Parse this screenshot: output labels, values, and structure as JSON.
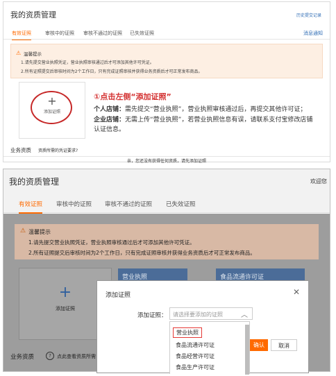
{
  "panel1": {
    "title": "我的资质管理",
    "history_link": "历史提交记录",
    "tabs": [
      "有效证照",
      "审核中的证照",
      "审核不通过的证照",
      "已失效证照"
    ],
    "message_link": "消息通知",
    "tip": {
      "heading": "温馨提示",
      "line1": "1.请先提交营业执照凭证，营业执照审核通过后才可添加其他许可凭证。",
      "line2": "2.所有证照提交后审核时间为2个工作日，只有完成证照审核并获得业务资质后才可正常发布商品。"
    },
    "add_label": "添加证照",
    "step_title": "①点击左侧“添加证照”",
    "personal_label": "个人店铺：",
    "personal_text": "需先提交“营业执照”，营业执照审核通过后，再提交其他许可证；",
    "enterprise_label": "企业店铺：",
    "enterprise_text": "无需上传“营业执照”，若营业执照信息有误，请联系支付宝修改店铺认证信息。",
    "business_label": "业务资质",
    "business_hint": "资质所需的凭证要求?",
    "footer": "亲，您还没有获得任何资质，请先添加证照"
  },
  "panel2": {
    "title": "我的资质管理",
    "welcome": "欢迎您",
    "tabs": [
      "有效证照",
      "审核中的证照",
      "审核不通过的证照",
      "已失效证照"
    ],
    "tip": {
      "heading": "温馨提示",
      "line1": "1.请先提交营业执照凭证，营业执照审核通过后才可添加其他许可凭证。",
      "line2": "2.所有证照提交后审核时间为2个工作日，只有完成证照审核并获得业务资质后才可正常发布商品。"
    },
    "add_label": "添加证照",
    "card1": "营业执照",
    "card2": "食品流通许可证",
    "business_label": "业务资质",
    "business_hint": "点此查看资质所需",
    "dialog": {
      "title": "添加证照",
      "field_label": "添加证照：",
      "placeholder": "请选择要添加的证照",
      "options": [
        "营业执照",
        "食品流通许可证",
        "食品经营许可证",
        "食品生产许可证"
      ],
      "confirm": "确认",
      "cancel": "取消"
    }
  },
  "colors": {
    "accent": "#ff6a00",
    "link": "#2f6db5",
    "highlight": "#d32f2f"
  }
}
